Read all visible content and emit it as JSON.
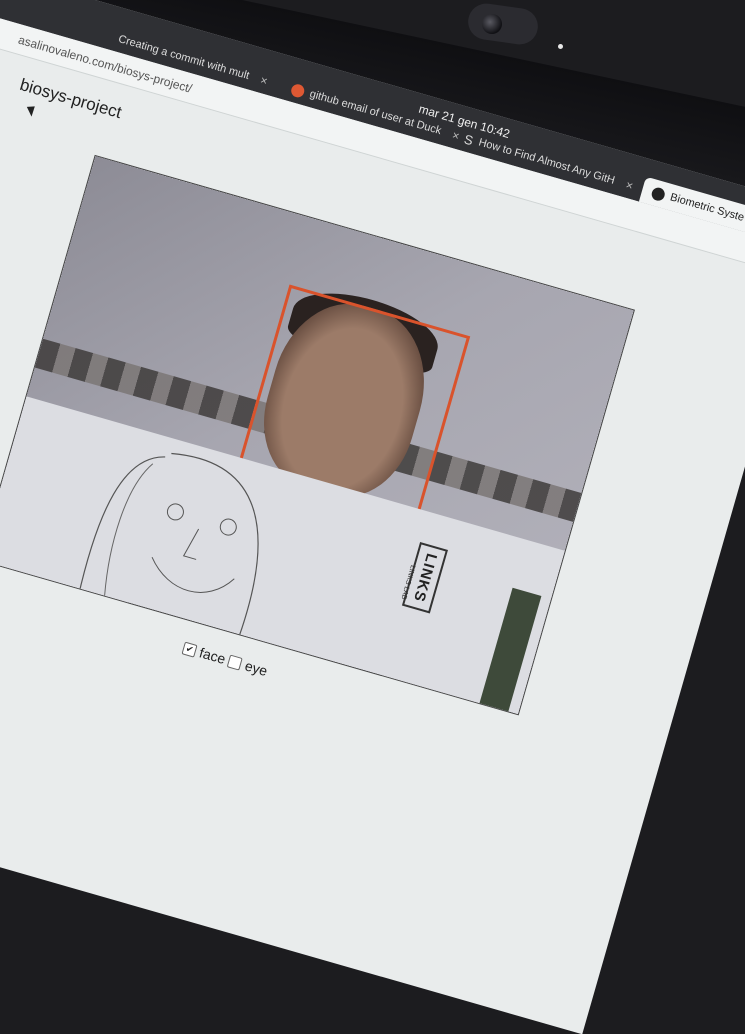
{
  "system": {
    "clock": "mar 21 gen  10:42"
  },
  "tabs": [
    {
      "label": "Creating a commit with mult",
      "icon": "github-icon",
      "active": false
    },
    {
      "label": "github email of user at Duck",
      "icon": "duckduckgo-icon",
      "active": false
    },
    {
      "label": "How to Find Almost Any GitH",
      "icon": "s-logo-icon",
      "active": false
    },
    {
      "label": "Biometric Syste",
      "icon": "github-icon",
      "active": true
    }
  ],
  "address": {
    "url": "asalinovaleno.com/biosys-project/"
  },
  "page": {
    "title": "biosys-project"
  },
  "video": {
    "paper_logo": "LINKS",
    "paper_sub": "LINKS LAB"
  },
  "controls": {
    "face": {
      "label": "face",
      "checked": true
    },
    "eye": {
      "label": "eye",
      "checked": false
    }
  },
  "colors": {
    "detection_box": "#d9532c",
    "tabbar": "#2f3034"
  }
}
